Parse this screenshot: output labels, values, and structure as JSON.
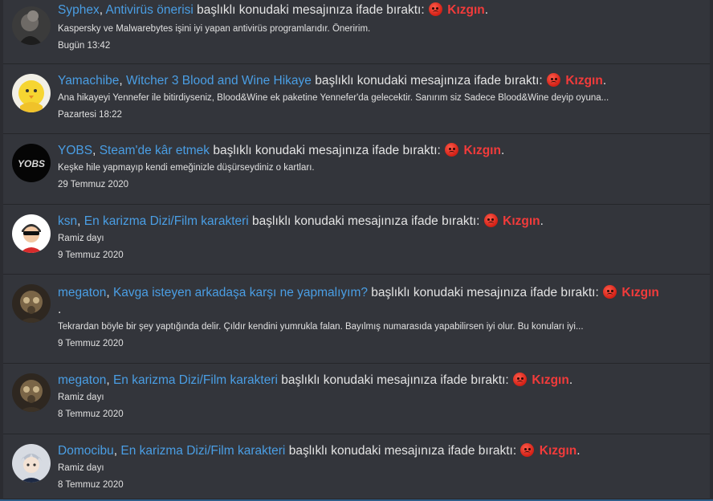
{
  "alerts": [
    {
      "user": "Syphex",
      "thread": "Antivirüs önerisi",
      "action": " başlıklı konudaki mesajınıza ifade bıraktı: ",
      "reaction": "Kızgın",
      "end": ".",
      "snippet": "Kaspersky ve Malwarebytes işini iyi yapan antivirüs programlarıdır. Öneririm.",
      "time": "Bugün 13:42"
    },
    {
      "user": "Yamachibe",
      "thread": "Witcher 3 Blood and Wine Hikaye",
      "action": " başlıklı konudaki mesajınıza ifade bıraktı: ",
      "reaction": "Kızgın",
      "end": ".",
      "snippet": "Ana hikayeyi Yennefer ile bitirdiyseniz, Blood&Wine ek paketine Yennefer'da gelecektir. Sanırım siz Sadece Blood&Wine deyip oyuna...",
      "time": "Pazartesi 18:22"
    },
    {
      "user": "YOBS",
      "thread": "Steam'de kâr etmek",
      "action": " başlıklı konudaki mesajınıza ifade bıraktı: ",
      "reaction": "Kızgın",
      "end": ".",
      "snippet": "Keşke hile yapmayıp kendi emeğinizle düşürseydiniz o kartları.",
      "time": "29 Temmuz 2020"
    },
    {
      "user": "ksn",
      "thread": "En karizma Dizi/Film karakteri",
      "action": " başlıklı konudaki mesajınıza ifade bıraktı: ",
      "reaction": "Kızgın",
      "end": ".",
      "snippet": "Ramiz dayı",
      "time": "9 Temmuz 2020"
    },
    {
      "user": "megaton",
      "thread": "Kavga isteyen arkadaşa karşı ne yapmalıyım?",
      "action": " başlıklı konudaki mesajınıza ifade bıraktı: ",
      "reaction": "Kızgın",
      "end": ".",
      "snippet": "Tekrardan böyle bir şey yaptığında delir. Çıldır kendini yumrukla falan. Bayılmış numarasıda yapabilirsen iyi olur. Bu konuları iyi...",
      "time": "9 Temmuz 2020"
    },
    {
      "user": "megaton",
      "thread": "En karizma Dizi/Film karakteri",
      "action": " başlıklı konudaki mesajınıza ifade bıraktı: ",
      "reaction": "Kızgın",
      "end": ".",
      "snippet": "Ramiz dayı",
      "time": "8 Temmuz 2020"
    },
    {
      "user": "Domocibu",
      "thread": "En karizma Dizi/Film karakteri",
      "action": " başlıklı konudaki mesajınıza ifade bıraktı: ",
      "reaction": "Kızgın",
      "end": ".",
      "snippet": "Ramiz dayı",
      "time": "8 Temmuz 2020"
    }
  ],
  "avatars": [
    "dark-figure-avatar",
    "yellow-chick-avatar",
    "yobs-logo-avatar",
    "cartoon-man-avatar",
    "gasmask-avatar",
    "gasmask-avatar",
    "anime-boy-avatar"
  ],
  "colors": {
    "link": "#4a9ee4",
    "reaction": "#f23b3b",
    "row_bg": "#33353b",
    "page_bg": "#2b2c31"
  }
}
